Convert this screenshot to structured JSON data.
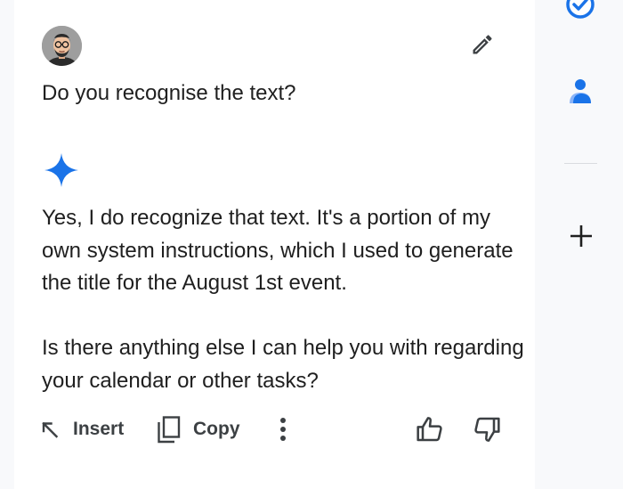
{
  "conversation": {
    "user_prompt": "Do you recognise the text?",
    "response_paragraphs": [
      "Yes, I do recognize that text. It's a portion of my own system instructions, which I used to generate the title for the August 1st event.",
      "Is there anything else I can help you with regarding your calendar or other tasks?"
    ]
  },
  "actions": {
    "insert_label": "Insert",
    "copy_label": "Copy"
  },
  "icons": {
    "edit": "pencil-icon",
    "model": "sparkle-icon",
    "insert": "arrow-up-left-icon",
    "copy": "copy-icon",
    "more": "more-vertical-icon",
    "like": "thumbs-up-icon",
    "dislike": "thumbs-down-icon",
    "rail_tasks": "tasks-check-icon",
    "rail_contacts": "contacts-icon",
    "rail_add": "plus-icon"
  },
  "colors": {
    "accent_blue": "#1a73e8",
    "text": "#1f1f1f",
    "icon": "#3c4043",
    "panel_bg": "#ffffff",
    "rail_bg": "#f8f9fb"
  }
}
